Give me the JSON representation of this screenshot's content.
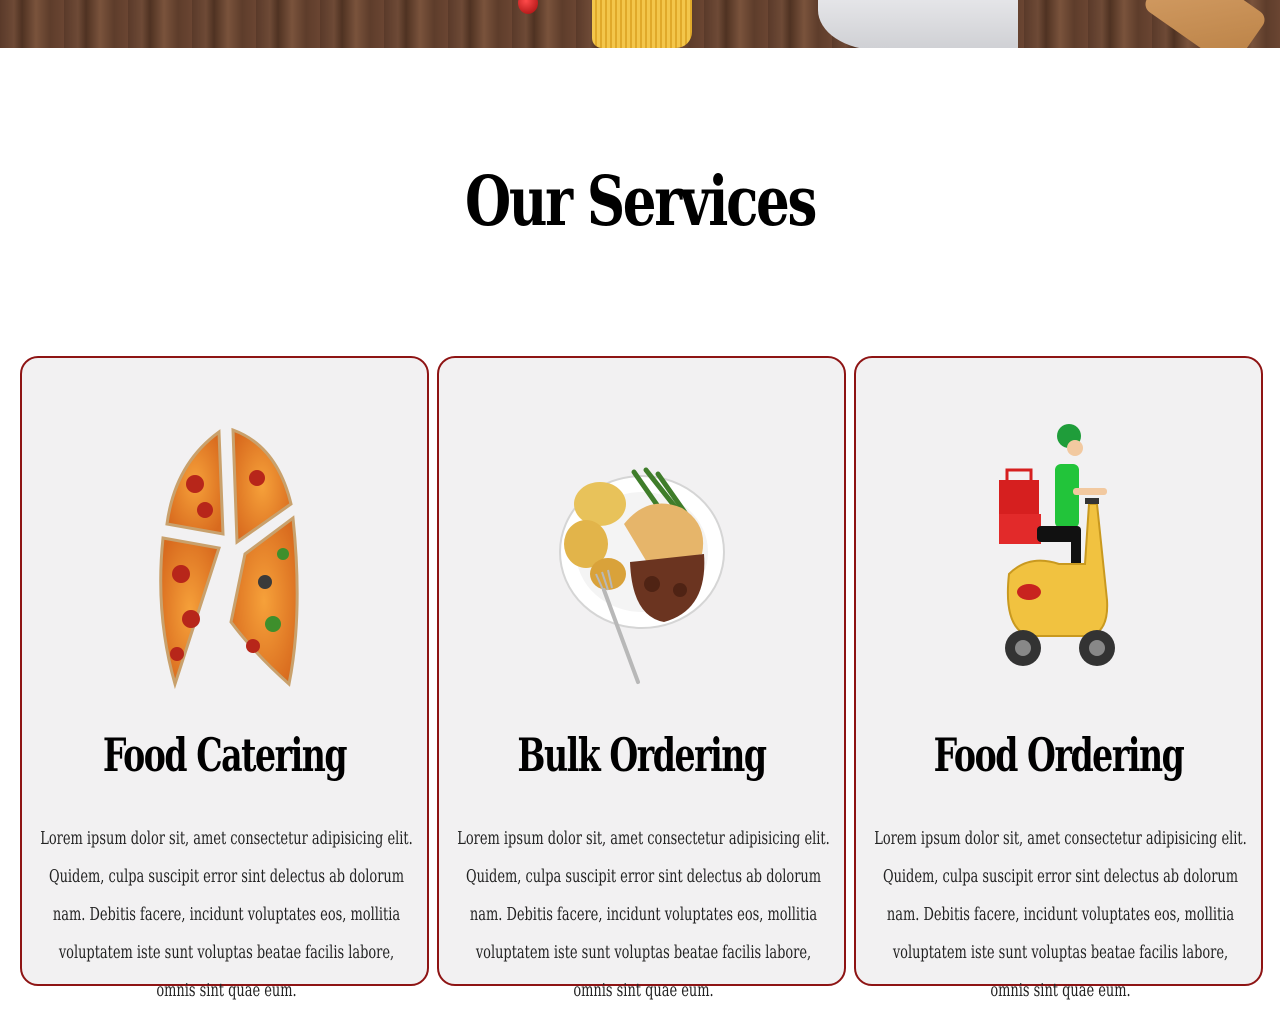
{
  "services": {
    "title": "Our Services",
    "cards": [
      {
        "title": "Food Catering",
        "icon": "pizza-slices-icon",
        "text": "Lorem ipsum dolor sit, amet consectetur adipisicing elit. Quidem, culpa suscipit error sint delectus ab dolorum nam. Debitis facere, incidunt voluptates eos, mollitia voluptatem iste sunt voluptas beatae facilis labore, omnis sint quae eum."
      },
      {
        "title": "Bulk Ordering",
        "icon": "meal-plate-icon",
        "text": "Lorem ipsum dolor sit, amet consectetur adipisicing elit. Quidem, culpa suscipit error sint delectus ab dolorum nam. Debitis facere, incidunt voluptates eos, mollitia voluptatem iste sunt voluptas beatae facilis labore, omnis sint quae eum."
      },
      {
        "title": "Food Ordering",
        "icon": "delivery-scooter-icon",
        "text": "Lorem ipsum dolor sit, amet consectetur adipisicing elit. Quidem, culpa suscipit error sint delectus ab dolorum nam. Debitis facere, incidunt voluptates eos, mollitia voluptatem iste sunt voluptas beatae facilis labore, omnis sint quae eum."
      }
    ]
  },
  "colors": {
    "card_border": "#8e1414",
    "card_background": "#f2f1f2"
  }
}
